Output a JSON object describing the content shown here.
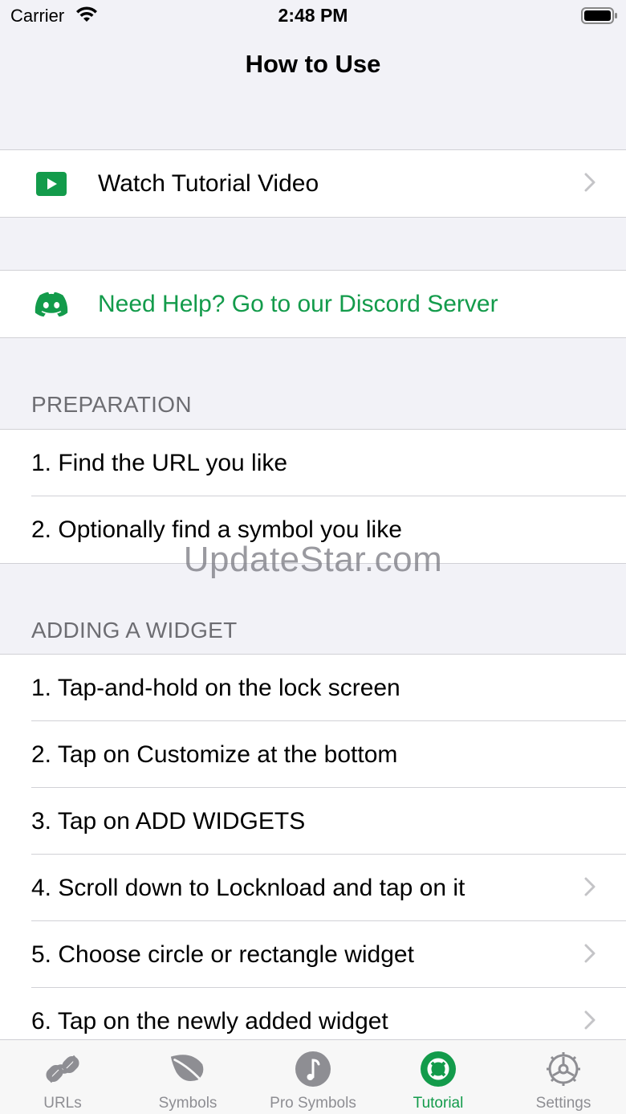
{
  "status_bar": {
    "carrier": "Carrier",
    "time": "2:48 PM"
  },
  "nav": {
    "title": "How to Use"
  },
  "links": {
    "tutorial_label": "Watch Tutorial Video",
    "discord_label": "Need Help? Go to our Discord Server"
  },
  "preparation": {
    "header": "PREPARATION",
    "items": [
      {
        "label": "1. Find the URL you like"
      },
      {
        "label": "2. Optionally find a symbol you like"
      }
    ]
  },
  "adding_widget": {
    "header": "ADDING A WIDGET",
    "items": [
      {
        "label": "1. Tap-and-hold on the lock screen"
      },
      {
        "label": "2. Tap on Customize at the bottom"
      },
      {
        "label": "3. Tap on ADD WIDGETS"
      },
      {
        "label": "4. Scroll down to Locknload and tap on it"
      },
      {
        "label": "5. Choose circle or rectangle widget"
      },
      {
        "label": "6. Tap on the newly added widget"
      }
    ]
  },
  "watermark": "UpdateStar.com",
  "tab_bar": {
    "tabs": [
      {
        "label": "URLs",
        "icon": "link-icon"
      },
      {
        "label": "Symbols",
        "icon": "leaf-icon"
      },
      {
        "label": "Pro Symbols",
        "icon": "music-note-circle-icon"
      },
      {
        "label": "Tutorial",
        "icon": "lifebuoy-icon",
        "active": true
      },
      {
        "label": "Settings",
        "icon": "gear-icon"
      }
    ]
  },
  "colors": {
    "accent": "#139b4b",
    "background": "#f2f2f7",
    "secondary_text": "#6d6d72",
    "inactive_tab": "#8e8e93"
  }
}
